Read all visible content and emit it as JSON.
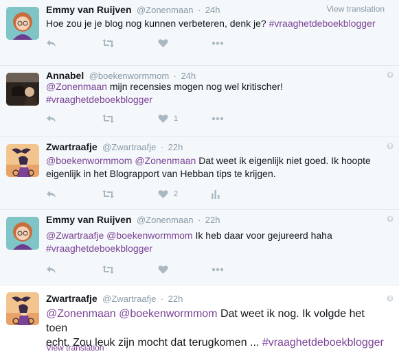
{
  "view_translation_label": "View translation",
  "tweets": [
    {
      "fullname": "Emmy van Ruijven",
      "username": "@Zonenmaan",
      "time": "24h",
      "text": [
        {
          "t": "text",
          "v": "Hoe zou je je blog nog kunnen verbeteren, denk je? "
        },
        {
          "t": "hashtag",
          "v": "#vraaghetdeboekblogger"
        }
      ],
      "like_count": "",
      "has_analytics": false
    },
    {
      "fullname": "Annabel",
      "username": "@boekenwormmom",
      "time": "24h",
      "text": [
        {
          "t": "mention",
          "v": "@Zonenmaan"
        },
        {
          "t": "text",
          "v": " mijn recensies mogen nog wel kritischer!"
        },
        {
          "t": "br"
        },
        {
          "t": "hashtag",
          "v": "#vraaghetdeboekblogger"
        }
      ],
      "like_count": "1",
      "has_analytics": false
    },
    {
      "fullname": "Zwartraafje",
      "username": "@Zwartraafje",
      "time": "22h",
      "text": [
        {
          "t": "mention",
          "v": "@boekenwormmom"
        },
        {
          "t": "text",
          "v": " "
        },
        {
          "t": "mention",
          "v": "@Zonenmaan"
        },
        {
          "t": "text",
          "v": " Dat weet ik eigenlijk niet goed. Ik hoopte"
        },
        {
          "t": "br"
        },
        {
          "t": "text",
          "v": "eigenlijk in het Blograpport van Hebban tips te krijgen."
        }
      ],
      "like_count": "2",
      "has_analytics": true
    },
    {
      "fullname": "Emmy van Ruijven",
      "username": "@Zonenmaan",
      "time": "22h",
      "text": [
        {
          "t": "mention",
          "v": "@Zwartraafje"
        },
        {
          "t": "text",
          "v": " "
        },
        {
          "t": "mention",
          "v": "@boekenwormmom"
        },
        {
          "t": "text",
          "v": " Ik heb daar voor gejureerd haha"
        },
        {
          "t": "br"
        },
        {
          "t": "hashtag",
          "v": "#vraaghetdeboekblogger"
        }
      ],
      "like_count": "",
      "has_analytics": false
    },
    {
      "fullname": "Zwartraafje",
      "username": "@Zwartraafje",
      "time": "22h",
      "text": [
        {
          "t": "mention",
          "v": "@Zonenmaan"
        },
        {
          "t": "text",
          "v": " "
        },
        {
          "t": "mention",
          "v": "@boekenwormmom"
        },
        {
          "t": "text",
          "v": " Dat weet ik nog. Ik volgde het toen"
        },
        {
          "t": "br"
        },
        {
          "t": "text",
          "v": "echt. Zou leuk zijn mocht dat terugkomen ... "
        },
        {
          "t": "hashtag",
          "v": "#vraaghetdeboekblogger"
        }
      ],
      "like_count": "",
      "has_analytics": false
    }
  ],
  "colors": {
    "link": "#7b4397",
    "meta": "#8899a6",
    "icon": "#aab8c2",
    "row_bg": "#f5f8fa",
    "border": "#e1e8ed"
  },
  "icons": [
    "reply-icon",
    "retweet-icon",
    "like-icon",
    "more-icon",
    "analytics-icon",
    "globe-icon"
  ]
}
